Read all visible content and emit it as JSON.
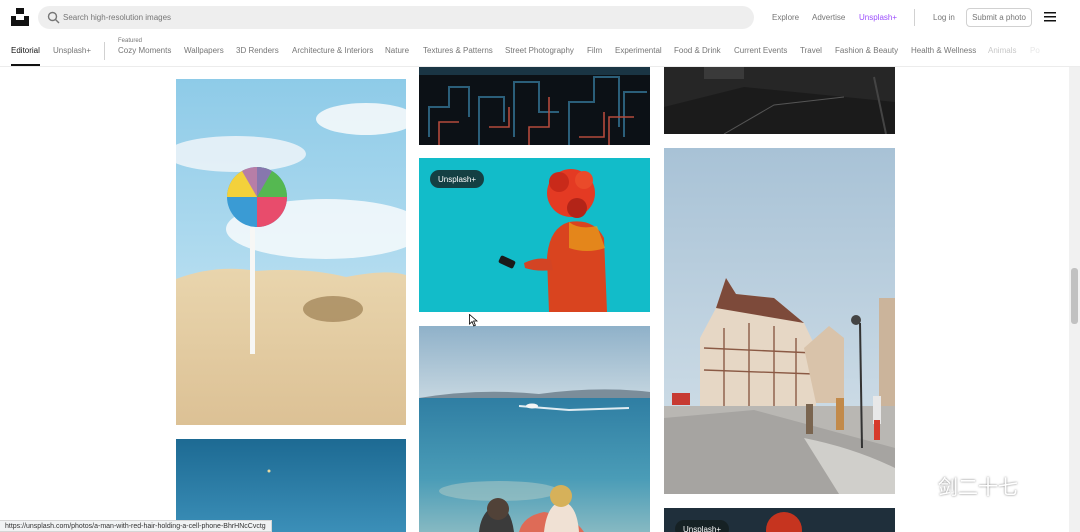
{
  "header": {
    "search_placeholder": "Search high-resolution images",
    "nav": [
      "Explore",
      "Advertise",
      "Unsplash+"
    ],
    "login": "Log in",
    "submit": "Submit a photo"
  },
  "categories": {
    "editorial": "Editorial",
    "unsplash_plus": "Unsplash+",
    "featured_label": "Featured",
    "items": [
      "Cozy Moments",
      "Wallpapers",
      "3D Renders",
      "Architecture & Interiors",
      "Nature",
      "Textures & Patterns",
      "Street Photography",
      "Film",
      "Experimental",
      "Food & Drink",
      "Current Events",
      "Travel",
      "Fashion & Beauty",
      "Health & Wellness",
      "Animals",
      "Po"
    ]
  },
  "photos": {
    "badge_red_hair": "Unsplash+",
    "badge_bottom": "Unsplash+"
  },
  "status_url": "https://unsplash.com/photos/a-man-with-red-hair-holding-a-cell-phone-BhrHNcCvctg",
  "watermark": "剑二十七",
  "colors": {
    "accent_plus": "#9b4dfc",
    "search_bg": "#eeeeee",
    "text_muted": "#767676"
  }
}
